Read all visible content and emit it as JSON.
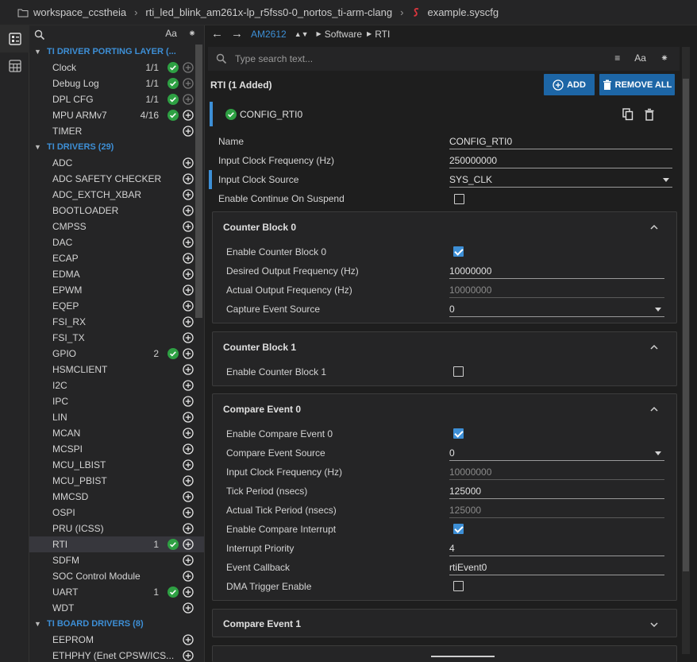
{
  "breadcrumb": {
    "workspace": "workspace_ccstheia",
    "project": "rti_led_blink_am261x-lp_r5fss0-0_nortos_ti-arm-clang",
    "file": "example.syscfg"
  },
  "tree": {
    "categories": [
      {
        "label": "TI DRIVER PORTING LAYER (...",
        "items": [
          {
            "label": "Clock",
            "count": "1/1",
            "ok": true
          },
          {
            "label": "Debug Log",
            "count": "1/1",
            "ok": true
          },
          {
            "label": "DPL CFG",
            "count": "1/1",
            "ok": true
          },
          {
            "label": "MPU ARMv7",
            "count": "4/16",
            "ok": true
          },
          {
            "label": "TIMER",
            "count": "",
            "ok": false
          }
        ]
      },
      {
        "label": "TI DRIVERS (29)",
        "items": [
          {
            "label": "ADC",
            "count": "",
            "ok": false
          },
          {
            "label": "ADC SAFETY CHECKER",
            "count": "",
            "ok": false
          },
          {
            "label": "ADC_EXTCH_XBAR",
            "count": "",
            "ok": false
          },
          {
            "label": "BOOTLOADER",
            "count": "",
            "ok": false
          },
          {
            "label": "CMPSS",
            "count": "",
            "ok": false
          },
          {
            "label": "DAC",
            "count": "",
            "ok": false
          },
          {
            "label": "ECAP",
            "count": "",
            "ok": false
          },
          {
            "label": "EDMA",
            "count": "",
            "ok": false
          },
          {
            "label": "EPWM",
            "count": "",
            "ok": false
          },
          {
            "label": "EQEP",
            "count": "",
            "ok": false
          },
          {
            "label": "FSI_RX",
            "count": "",
            "ok": false
          },
          {
            "label": "FSI_TX",
            "count": "",
            "ok": false
          },
          {
            "label": "GPIO",
            "count": "2",
            "ok": true
          },
          {
            "label": "HSMCLIENT",
            "count": "",
            "ok": false
          },
          {
            "label": "I2C",
            "count": "",
            "ok": false
          },
          {
            "label": "IPC",
            "count": "",
            "ok": false
          },
          {
            "label": "LIN",
            "count": "",
            "ok": false
          },
          {
            "label": "MCAN",
            "count": "",
            "ok": false
          },
          {
            "label": "MCSPI",
            "count": "",
            "ok": false
          },
          {
            "label": "MCU_LBIST",
            "count": "",
            "ok": false
          },
          {
            "label": "MCU_PBIST",
            "count": "",
            "ok": false
          },
          {
            "label": "MMCSD",
            "count": "",
            "ok": false
          },
          {
            "label": "OSPI",
            "count": "",
            "ok": false
          },
          {
            "label": "PRU (ICSS)",
            "count": "",
            "ok": false
          },
          {
            "label": "RTI",
            "count": "1",
            "ok": true,
            "selected": true
          },
          {
            "label": "SDFM",
            "count": "",
            "ok": false
          },
          {
            "label": "SOC Control Module",
            "count": "",
            "ok": false
          },
          {
            "label": "UART",
            "count": "1",
            "ok": true
          },
          {
            "label": "WDT",
            "count": "",
            "ok": false
          }
        ]
      },
      {
        "label": "TI BOARD DRIVERS (8)",
        "items": [
          {
            "label": "EEPROM",
            "count": "",
            "ok": false
          },
          {
            "label": "ETHPHY (Enet CPSW/ICS...",
            "count": "",
            "ok": false
          }
        ]
      }
    ]
  },
  "nav": {
    "device": "AM2612",
    "path1": "Software",
    "path2": "RTI"
  },
  "search": {
    "placeholder": "Type search text...",
    "font_label": "Aa"
  },
  "module": {
    "title": "RTI (1 Added)",
    "add_label": "ADD",
    "remove_label": "REMOVE ALL",
    "instance_name": "CONFIG_RTI0"
  },
  "config": {
    "name_label": "Name",
    "name_value": "CONFIG_RTI0",
    "freq_label": "Input Clock Frequency (Hz)",
    "freq_value": "250000000",
    "source_label": "Input Clock Source",
    "source_value": "SYS_CLK",
    "suspend_label": "Enable Continue On Suspend"
  },
  "counter0": {
    "title": "Counter Block 0",
    "enable_label": "Enable Counter Block 0",
    "desired_label": "Desired Output Frequency (Hz)",
    "desired_value": "10000000",
    "actual_label": "Actual Output Frequency (Hz)",
    "actual_value": "10000000",
    "capture_label": "Capture Event Source",
    "capture_value": "0"
  },
  "counter1": {
    "title": "Counter Block 1",
    "enable_label": "Enable Counter Block 1"
  },
  "compare0": {
    "title": "Compare Event 0",
    "enable_label": "Enable Compare Event 0",
    "source_label": "Compare Event Source",
    "source_value": "0",
    "inclk_label": "Input Clock Frequency (Hz)",
    "inclk_value": "10000000",
    "tick_label": "Tick Period (nsecs)",
    "tick_value": "125000",
    "actual_label": "Actual Tick Period (nsecs)",
    "actual_value": "125000",
    "intr_label": "Enable Compare Interrupt",
    "prio_label": "Interrupt Priority",
    "prio_value": "4",
    "cb_label": "Event Callback",
    "cb_value": "rtiEvent0",
    "dma_label": "DMA Trigger Enable"
  },
  "compare1": {
    "title": "Compare Event 1"
  },
  "colors": {
    "accent": "#3d8fd6",
    "ok": "#2ea043",
    "button": "#1d66a6"
  }
}
